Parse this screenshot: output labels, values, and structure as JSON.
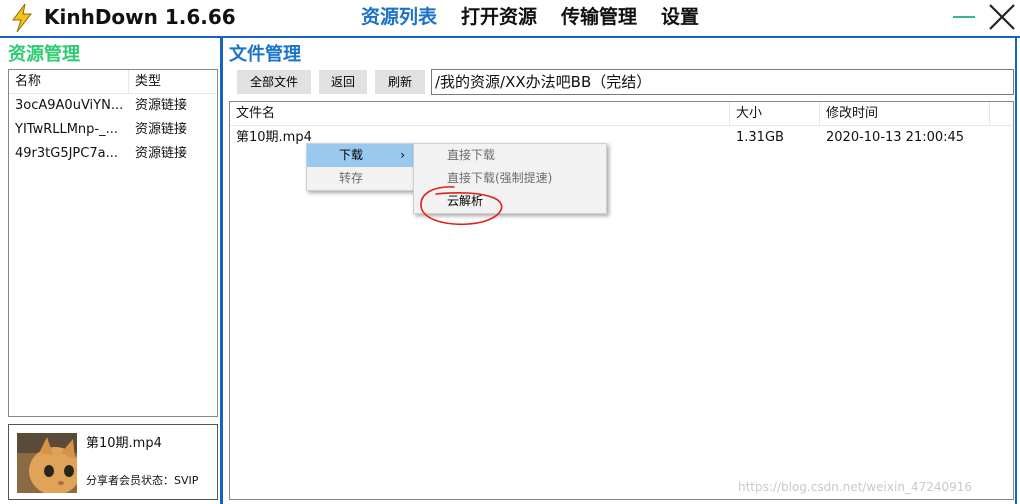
{
  "app": {
    "title": "KinhDown 1.6.66"
  },
  "nav": {
    "items": [
      {
        "label": "资源列表",
        "active": true
      },
      {
        "label": "打开资源",
        "active": false
      },
      {
        "label": "传输管理",
        "active": false
      },
      {
        "label": "设置",
        "active": false
      }
    ]
  },
  "left": {
    "title": "资源管理",
    "columns": {
      "name": "名称",
      "type": "类型"
    },
    "rows": [
      {
        "name": "3ocA9A0uViYN...",
        "type": "资源链接"
      },
      {
        "name": "YITwRLLMnp-_...",
        "type": "资源链接"
      },
      {
        "name": "49r3tG5JPC7a...",
        "type": "资源链接"
      }
    ],
    "share_card": {
      "file": "第10期.mp4",
      "status": "分享者会员状态：SVIP"
    }
  },
  "right": {
    "title": "文件管理",
    "toolbar": {
      "all_files": "全部文件",
      "back": "返回",
      "refresh": "刷新"
    },
    "path": "/我的资源/XX办法吧BB（完结）",
    "columns": {
      "name": "文件名",
      "size": "大小",
      "mtime": "修改时间"
    },
    "rows": [
      {
        "name": "第10期.mp4",
        "size": "1.31GB",
        "mtime": "2020-10-13 21:00:45"
      }
    ]
  },
  "context_menu": {
    "items": [
      {
        "label": "下载",
        "arrow": "›"
      },
      {
        "label": "转存"
      }
    ],
    "submenu": [
      {
        "label": "直接下载"
      },
      {
        "label": "直接下载(强制提速)"
      },
      {
        "label": "云解析"
      }
    ]
  },
  "watermark": "https://blog.csdn.net/weixin_47240916",
  "colors": {
    "accent_blue": "#1a73c8",
    "accent_green": "#2ecc71",
    "frame_blue": "#1565c0",
    "menu_highlight": "#99c9ef",
    "annotation_red": "#e02020"
  },
  "icons": {
    "logo": "lightning-icon",
    "minimize": "minimize-icon",
    "close": "close-icon"
  }
}
